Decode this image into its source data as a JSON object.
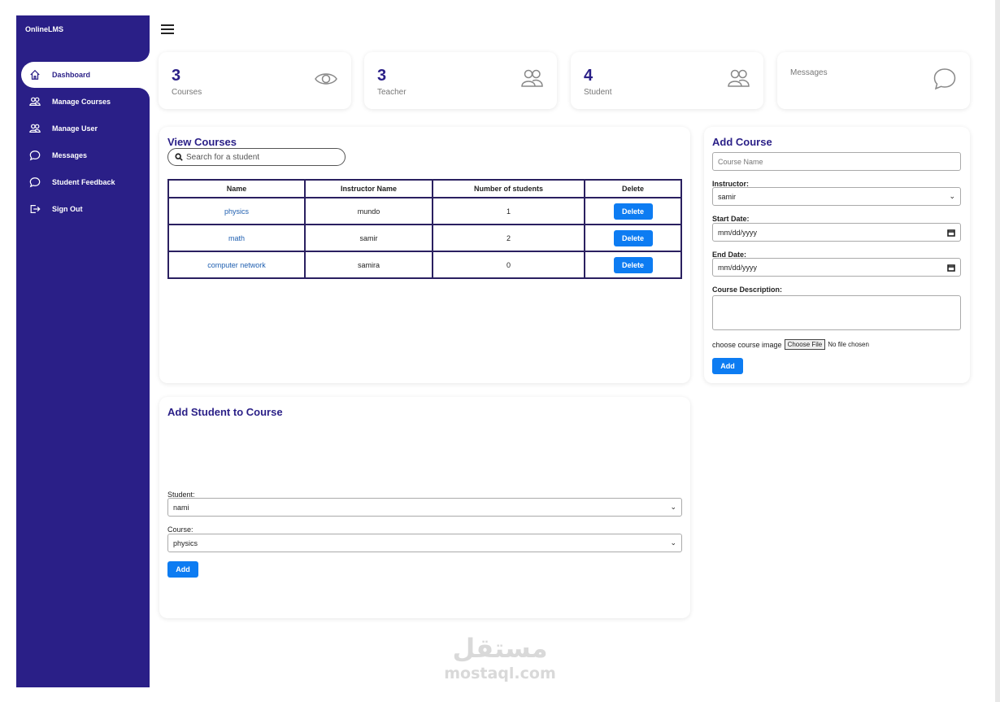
{
  "app": {
    "brand": "OnlineLMS"
  },
  "sidebar": {
    "items": [
      {
        "label": "Dashboard",
        "icon": "home-icon",
        "active": true
      },
      {
        "label": "Manage Courses",
        "icon": "users-icon"
      },
      {
        "label": "Manage User",
        "icon": "users-icon"
      },
      {
        "label": "Messages",
        "icon": "chat-icon"
      },
      {
        "label": "Student Feedback",
        "icon": "chat-icon"
      },
      {
        "label": "Sign Out",
        "icon": "sign-out-icon"
      }
    ]
  },
  "stats": [
    {
      "value": "3",
      "label": "Courses",
      "icon": "eye-icon"
    },
    {
      "value": "3",
      "label": "Teacher",
      "icon": "users-icon"
    },
    {
      "value": "4",
      "label": "Student",
      "icon": "users-icon"
    },
    {
      "value": "",
      "label": "Messages",
      "icon": "chat-icon"
    }
  ],
  "view_courses": {
    "title": "View Courses",
    "search_placeholder": "Search for a student",
    "columns": [
      "Name",
      "Instructor Name",
      "Number of students",
      "Delete"
    ],
    "rows": [
      {
        "name": "physics",
        "instructor": "mundo",
        "students": "1",
        "action": "Delete"
      },
      {
        "name": "math",
        "instructor": "samir",
        "students": "2",
        "action": "Delete"
      },
      {
        "name": "computer network",
        "instructor": "samira",
        "students": "0",
        "action": "Delete"
      }
    ]
  },
  "add_course": {
    "title": "Add Course",
    "name_placeholder": "Course Name",
    "instructor_label": "Instructor:",
    "instructor_value": "samir",
    "start_label": "Start Date:",
    "start_value": "mm/dd/yyyy",
    "end_label": "End Date:",
    "end_value": "mm/dd/yyyy",
    "desc_label": "Course Description:",
    "image_label": "choose course image",
    "file_button": "Choose File",
    "file_status": "No file chosen",
    "add_label": "Add"
  },
  "add_student": {
    "title": "Add Student to Course",
    "student_label": "Student:",
    "student_value": "nami",
    "course_label": "Course:",
    "course_value": "physics",
    "add_label": "Add"
  },
  "watermark": {
    "arabic": "مستقل",
    "latin": "mostaql.com"
  },
  "colors": {
    "sidebar": "#2a1f87",
    "accent": "#0d7cf2",
    "heading": "#2a1f87"
  }
}
